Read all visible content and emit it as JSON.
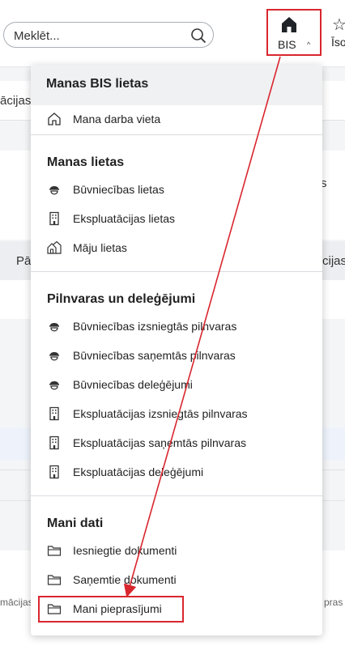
{
  "header": {
    "search_placeholder": "Meklēt...",
    "bis_label": "BIS",
    "bis_chevron": "^",
    "iso_label": "Īso",
    "star_glyph": "☆"
  },
  "background": {
    "frag_top": "ācijas",
    "frag_pa": "Pā",
    "frag_s": "s",
    "frag_cijas": "cijas",
    "frag_bottom_left": "mācijas",
    "frag_bottom_right": "pras sis"
  },
  "menu": {
    "title": "Manas BIS lietas",
    "items_top": [
      {
        "label": "Mana darba vieta",
        "icon": "home-outline-icon"
      }
    ],
    "sections": [
      {
        "title": "Manas lietas",
        "items": [
          {
            "label": "Būvniecības lietas",
            "icon": "worker-icon"
          },
          {
            "label": "Ekspluatācijas lietas",
            "icon": "building-icon"
          },
          {
            "label": "Māju lietas",
            "icon": "houses-icon"
          }
        ]
      },
      {
        "title": "Pilnvaras un deleģējumi",
        "items": [
          {
            "label": "Būvniecības izsniegtās pilnvaras",
            "icon": "worker-icon"
          },
          {
            "label": "Būvniecības saņemtās pilnvaras",
            "icon": "worker-icon"
          },
          {
            "label": "Būvniecības deleģējumi",
            "icon": "worker-icon"
          },
          {
            "label": "Ekspluatācijas izsniegtās pilnvaras",
            "icon": "building-icon"
          },
          {
            "label": "Ekspluatācijas saņemtās pilnvaras",
            "icon": "building-icon"
          },
          {
            "label": "Ekspluatācijas deleģējumi",
            "icon": "building-icon"
          }
        ]
      },
      {
        "title": "Mani dati",
        "items": [
          {
            "label": "Iesniegtie dokumenti",
            "icon": "folder-icon"
          },
          {
            "label": "Saņemtie dokumenti",
            "icon": "folder-icon"
          },
          {
            "label": "Mani pieprasījumi",
            "icon": "folder-icon"
          }
        ]
      }
    ]
  },
  "colors": {
    "highlight": "#d9262e"
  }
}
